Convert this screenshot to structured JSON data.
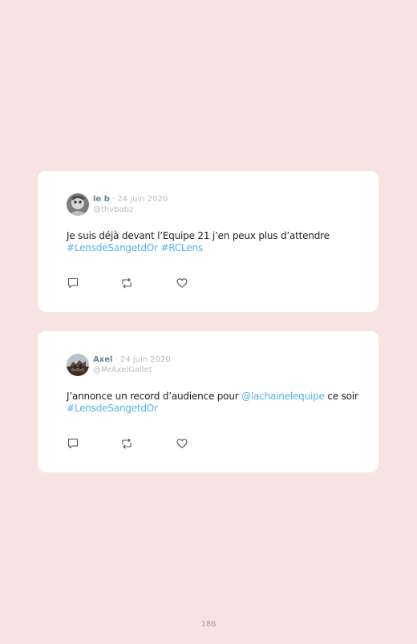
{
  "tweets": [
    {
      "author_name": "le b",
      "separator": "·",
      "date": "24 juin 2020",
      "handle": "@thvbabz",
      "text_1": "Je suis déjà devant l’Equipe 21 j’en peux plus d’attendre",
      "hashtag_1": "#LensdeSangetdOr",
      "hashtag_2": "#RCLens",
      "icons": [
        "reply-icon",
        "retweet-icon",
        "like-icon"
      ]
    },
    {
      "author_name": "Axel",
      "separator": "·",
      "date": "24 juin 2020",
      "handle": "@MrAxelGallet",
      "text_1": "J’annonce un record d’audience pour",
      "mention": "@lachainelequipe",
      "text_2": "ce soir",
      "hashtag_1": "#LensdeSangetdOr",
      "icons": [
        "reply-icon",
        "retweet-icon",
        "like-icon"
      ]
    }
  ],
  "page_number": "186",
  "colors": {
    "background": "#f6e3e2",
    "card": "#ffffff",
    "link": "#56b3e8",
    "name": "#6b8399",
    "muted": "#b9bdc2"
  }
}
